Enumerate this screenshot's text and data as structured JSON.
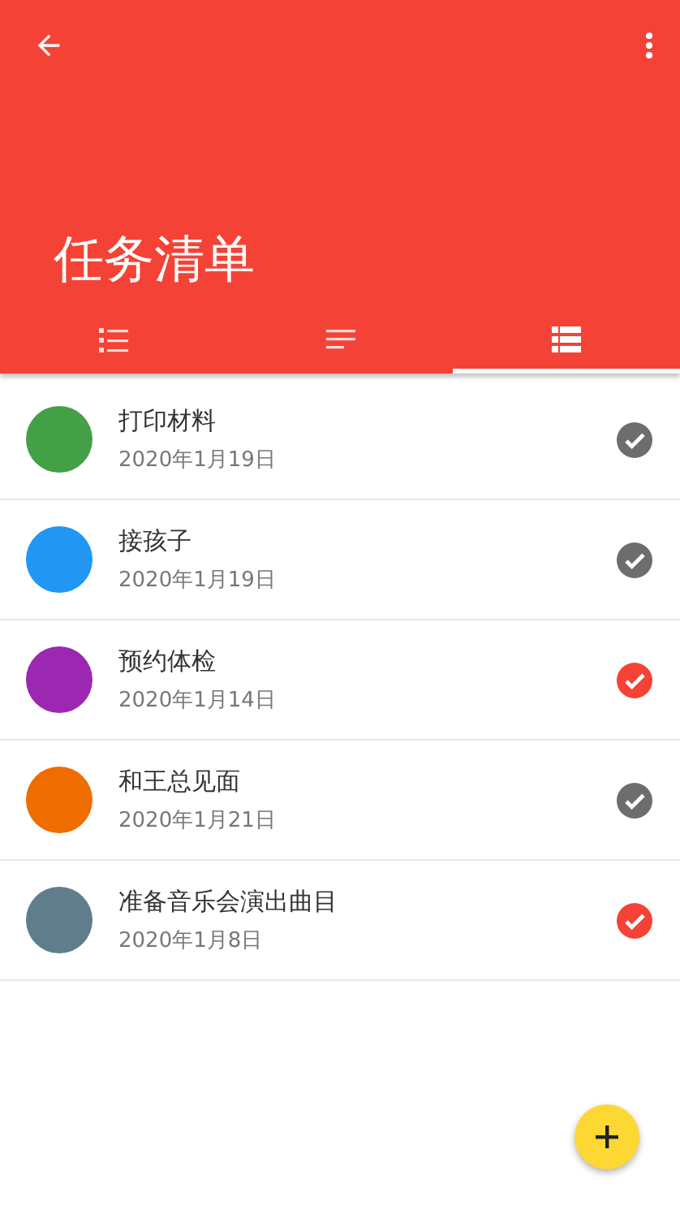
{
  "app_bar": {
    "title": "任务清单"
  },
  "tabs": [
    {
      "kind": "numbered",
      "selected": false
    },
    {
      "kind": "lines",
      "selected": false
    },
    {
      "kind": "list",
      "selected": true
    }
  ],
  "tasks": [
    {
      "title": "打印材料",
      "date": "2020年1月19日",
      "color": "#43a047",
      "checked": false
    },
    {
      "title": "接孩子",
      "date": "2020年1月19日",
      "color": "#2196f3",
      "checked": false
    },
    {
      "title": "预约体检",
      "date": "2020年1月14日",
      "color": "#9c27b0",
      "checked": true
    },
    {
      "title": "和王总见面",
      "date": "2020年1月21日",
      "color": "#ef6c00",
      "checked": false
    },
    {
      "title": "准备音乐会演出曲目",
      "date": "2020年1月8日",
      "color": "#607d8b",
      "checked": true
    }
  ]
}
